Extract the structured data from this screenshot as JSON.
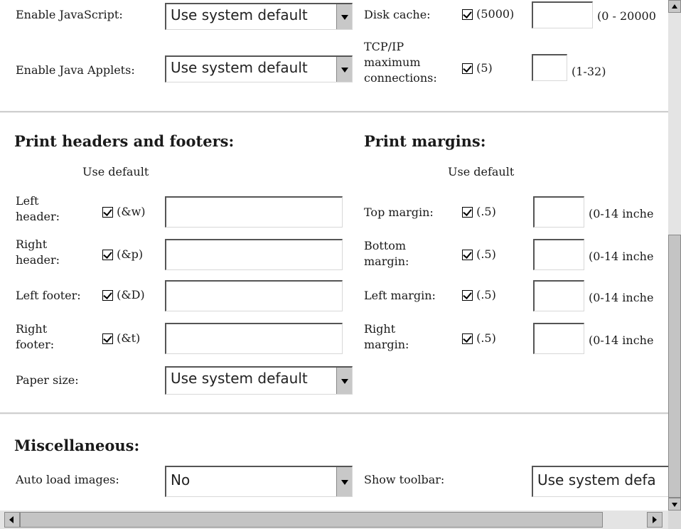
{
  "general": {
    "javascript": {
      "label": "Enable JavaScript:",
      "value": "Use system default"
    },
    "java_applets": {
      "label": "Enable Java Applets:",
      "value": "Use system default"
    },
    "disk_cache": {
      "label": "Disk cache:",
      "default": "(5000)",
      "range": "(0 - 20000"
    },
    "tcpip": {
      "label_lines": [
        "TCP/IP",
        "maximum",
        "connections:"
      ],
      "default": "(5)",
      "range": "(1-32)"
    }
  },
  "print_headers": {
    "heading": "Print headers and footers:",
    "use_default": "Use default",
    "rows": [
      {
        "label_lines": [
          "Left",
          "header:"
        ],
        "default": "(&w)"
      },
      {
        "label_lines": [
          "Right",
          "header:"
        ],
        "default": "(&p)"
      },
      {
        "label_lines": [
          "Left footer:"
        ],
        "default": "(&D)"
      },
      {
        "label_lines": [
          "Right",
          "footer:"
        ],
        "default": "(&t)"
      }
    ],
    "paper_size": {
      "label": "Paper size:",
      "value": "Use system default"
    }
  },
  "print_margins": {
    "heading": "Print margins:",
    "use_default": "Use default",
    "rows": [
      {
        "label_lines": [
          "Top margin:"
        ],
        "default": "(.5)",
        "range": "(0-14 inche"
      },
      {
        "label_lines": [
          "Bottom",
          "margin:"
        ],
        "default": "(.5)",
        "range": "(0-14 inche"
      },
      {
        "label_lines": [
          "Left margin:"
        ],
        "default": "(.5)",
        "range": "(0-14 inche"
      },
      {
        "label_lines": [
          "Right",
          "margin:"
        ],
        "default": "(.5)",
        "range": "(0-14 inche"
      }
    ]
  },
  "misc": {
    "heading": "Miscellaneous:",
    "auto_load_images": {
      "label": "Auto load images:",
      "value": "No"
    },
    "show_toolbar": {
      "label": "Show toolbar:",
      "value": "Use system defa"
    }
  },
  "icons": {
    "checkbox": "checked-checkbox-icon",
    "dropdown": "chevron-down-icon",
    "scroll_up": "arrow-up-icon",
    "scroll_down": "arrow-down-icon",
    "scroll_left": "arrow-left-icon",
    "scroll_right": "arrow-right-icon"
  }
}
